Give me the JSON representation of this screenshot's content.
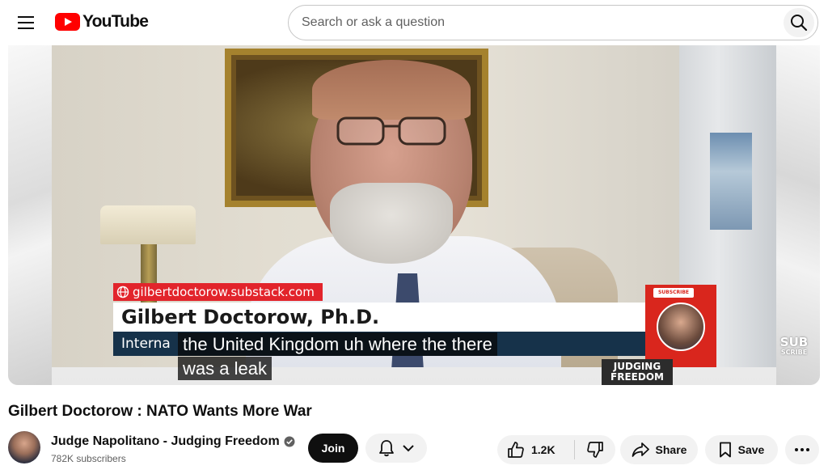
{
  "header": {
    "logo_text": "YouTube",
    "search_placeholder": "Search or ask a question",
    "icons": {
      "menu": "hamburger-menu-icon",
      "logo": "youtube-play-icon",
      "search": "search-icon"
    }
  },
  "player": {
    "lower_third": {
      "url": "gilbertdoctorow.substack.com",
      "name": "Gilbert Doctorow,  Ph.D.",
      "title_visible": "Interna"
    },
    "brand": {
      "subscribe_badge": "SUBSCRIBE",
      "name": "JUDGING FREEDOM"
    },
    "watermark": {
      "big": "SUB",
      "small": "SCRIBE"
    },
    "captions": [
      "the United Kingdom uh where the there",
      "was a leak"
    ]
  },
  "video": {
    "title": "Gilbert Doctorow : NATO Wants More War"
  },
  "channel": {
    "name": "Judge Napolitano - Judging Freedom",
    "verified": true,
    "subscribers": "782K subscribers"
  },
  "actions": {
    "join": "Join",
    "likes": "1.2K",
    "share": "Share",
    "save": "Save"
  },
  "colors": {
    "brand_red": "#ff0000",
    "lower_third_red": "#e2242b",
    "lower_third_navy": "#16324a"
  }
}
